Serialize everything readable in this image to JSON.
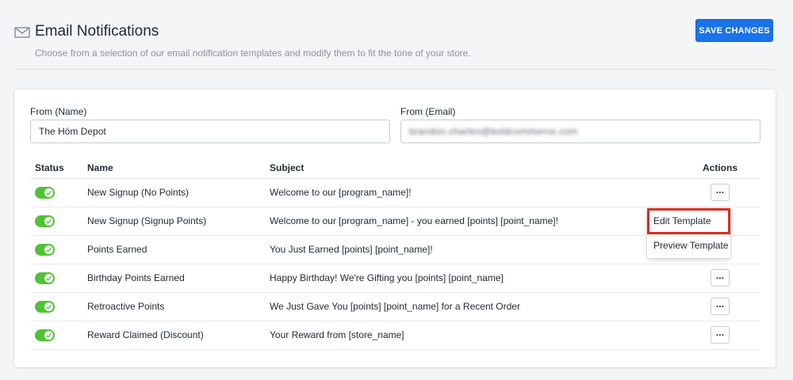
{
  "header": {
    "title": "Email Notifications",
    "subtitle": "Choose from a selection of our email notification templates and modify them to fit the tone of your store.",
    "save_label": "SAVE CHANGES",
    "icon": "mail-icon"
  },
  "form": {
    "from_name_label": "From (Name)",
    "from_name_value": "The Höm Depot",
    "from_email_label": "From (Email)",
    "from_email_value": "brandon.charles@boldcommerce.com"
  },
  "table": {
    "columns": {
      "status": "Status",
      "name": "Name",
      "subject": "Subject",
      "actions": "Actions"
    },
    "rows": [
      {
        "enabled": true,
        "name": "New Signup (No Points)",
        "subject": "Welcome to our [program_name]!"
      },
      {
        "enabled": true,
        "name": "New Signup (Signup Points)",
        "subject": "Welcome to our [program_name] - you earned [points] [point_name]!"
      },
      {
        "enabled": true,
        "name": "Points Earned",
        "subject": "You Just Earned [points] [point_name]!"
      },
      {
        "enabled": true,
        "name": "Birthday Points Earned",
        "subject": "Happy Birthday! We're Gifting you [points] [point_name]"
      },
      {
        "enabled": true,
        "name": "Retroactive Points",
        "subject": "We Just Gave You [points] [point_name] for a Recent Order"
      },
      {
        "enabled": true,
        "name": "Reward Claimed (Discount)",
        "subject": "Your Reward from [store_name]"
      }
    ],
    "action_glyph": "···"
  },
  "action_menu": {
    "items": [
      "Edit Template",
      "Preview Template"
    ]
  },
  "colors": {
    "primary": "#1a73e8",
    "toggle_on": "#50c234",
    "highlight": "#d92d20"
  }
}
